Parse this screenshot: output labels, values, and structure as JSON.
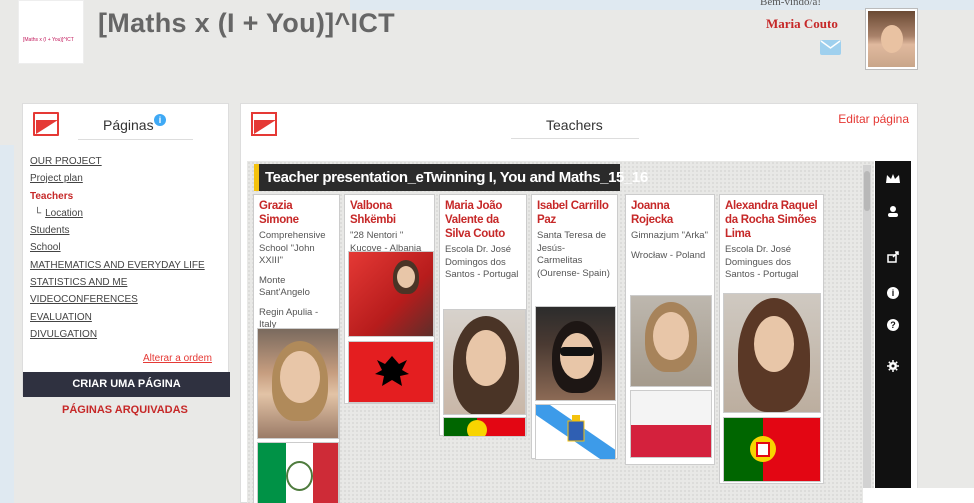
{
  "header": {
    "logo_text": "[Maths x (I + You)]^ICT",
    "site_title": "[Maths x (I + You)]^ICT",
    "welcome_text": "Bem-vindo/a!",
    "user_name": "Maria Couto"
  },
  "sidebar": {
    "title": "Páginas",
    "info_icon": "i",
    "items": [
      {
        "label": "OUR PROJECT",
        "active": false
      },
      {
        "label": "Project plan",
        "active": false
      },
      {
        "label": "Teachers",
        "active": true
      },
      {
        "label": "Location",
        "active": false
      },
      {
        "label": "Students",
        "active": false
      },
      {
        "label": "School",
        "active": false
      },
      {
        "label": "MATHEMATICS AND EVERYDAY LIFE",
        "active": false
      },
      {
        "label": "STATISTICS AND ME",
        "active": false
      },
      {
        "label": "VIDEOCONFERENCES",
        "active": false
      },
      {
        "label": "EVALUATION",
        "active": false
      },
      {
        "label": "DIVULGATION",
        "active": false
      }
    ],
    "reorder_link": "Alterar a ordem",
    "create_button": "CRIAR UMA PÁGINA",
    "archived_link": "PÁGINAS ARQUIVADAS"
  },
  "main": {
    "title": "Teachers",
    "edit_link": "Editar página",
    "board_title": "Teacher presentation_eTwinning I, You and Maths_15_16",
    "cards": [
      {
        "name": "Grazia Simone",
        "desc": [
          "Comprehensive School \"John XXIII\"",
          "Monte Sant'Angelo",
          "Regin Apulia - Italy"
        ],
        "flag": "italy"
      },
      {
        "name": "Valbona Shkëmbi",
        "desc": [
          "\"28 Nentori \" Kucove - Albania"
        ],
        "flag": "albania"
      },
      {
        "name": "Maria João Valente da Silva Couto",
        "desc": [
          "Escola Dr. José Domingos dos Santos - Portugal"
        ],
        "flag": "portugal"
      },
      {
        "name": "Isabel Carrillo Paz",
        "desc": [
          "Santa Teresa de Jesús- Carmelitas (Ourense- Spain)"
        ],
        "flag": "galicia"
      },
      {
        "name": "Joanna Rojecka",
        "desc": [
          "Gimnazjum \"Arka\"",
          "Wrocław - Poland"
        ],
        "flag": "poland"
      },
      {
        "name": "Alexandra Raquel da Rocha Simões Lima",
        "desc": [
          "Escola Dr. José Domingues dos Santos - Portugal"
        ],
        "flag": "portugal"
      }
    ]
  },
  "toolbar": {
    "icons": [
      "crown-icon",
      "user-icon",
      "share-icon",
      "info-icon",
      "help-icon",
      "settings-icon"
    ]
  },
  "colors": {
    "accent_red": "#c62828",
    "dark": "#2f3140",
    "info_blue": "#3fa9f5"
  }
}
